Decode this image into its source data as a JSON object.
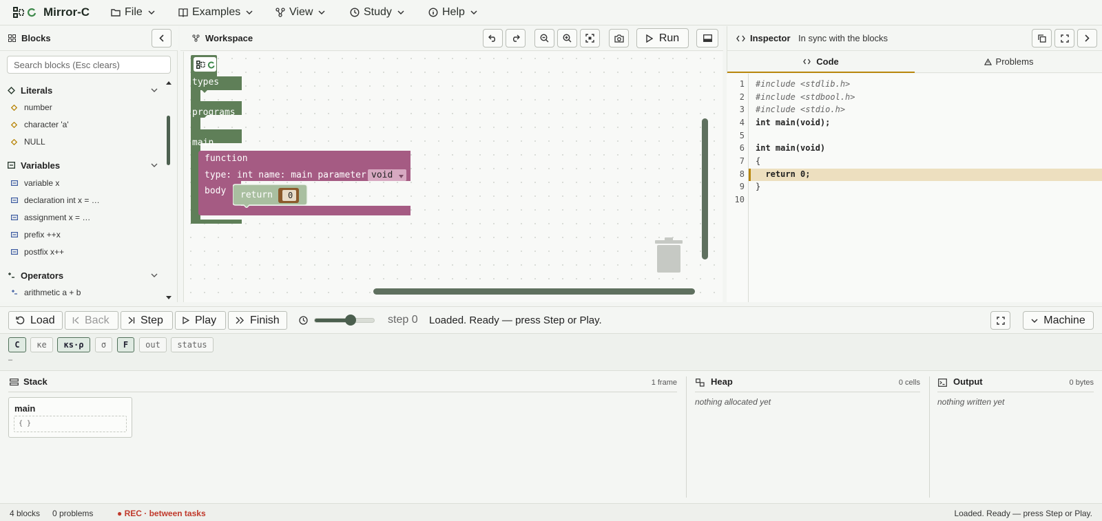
{
  "app": {
    "title": "Mirror-C"
  },
  "menu": [
    {
      "label": "File",
      "icon": "folder-icon"
    },
    {
      "label": "Examples",
      "icon": "book-icon"
    },
    {
      "label": "View",
      "icon": "network-icon"
    },
    {
      "label": "Study",
      "icon": "clock-icon"
    },
    {
      "label": "Help",
      "icon": "info-icon"
    }
  ],
  "blocks_panel": {
    "title": "Blocks",
    "search_placeholder": "Search blocks (Esc clears)",
    "categories": [
      {
        "label": "Literals",
        "items": [
          "number",
          "character 'a'",
          "NULL"
        ]
      },
      {
        "label": "Variables",
        "items": [
          "variable x",
          "declaration int x = …",
          "assignment x = …",
          "prefix ++x",
          "postfix x++"
        ]
      },
      {
        "label": "Operators",
        "items": [
          "arithmetic a + b"
        ]
      }
    ]
  },
  "workspace": {
    "title": "Workspace",
    "run_label": "Run",
    "blocks": {
      "types": "types",
      "programs": "programs",
      "main": "main",
      "function": "function",
      "signature": "type: int name: main parameter",
      "param_value": "void",
      "body": "body",
      "return": "return",
      "return_value": "0"
    }
  },
  "inspector": {
    "title": "Inspector",
    "sync_status": "In sync with the blocks",
    "tabs": [
      {
        "label": "Code",
        "active": true
      },
      {
        "label": "Problems",
        "active": false
      }
    ],
    "highlighted_line": 8,
    "code_lines": [
      "#include <stdlib.h>",
      "#include <stdbool.h>",
      "#include <stdio.h>",
      "int main(void);",
      "",
      "int main(void)",
      "{",
      "  return 0;",
      "}",
      ""
    ]
  },
  "controls": {
    "load": "Load",
    "back": "Back",
    "step": "Step",
    "play": "Play",
    "finish": "Finish",
    "speed": 0.6,
    "step_label": "step 0",
    "message": "Loaded. Ready — press Step or Play.",
    "machine": "Machine",
    "chips": [
      {
        "label": "C",
        "active": true
      },
      {
        "label": "κe",
        "active": false
      },
      {
        "label": "κs·ρ",
        "active": true
      },
      {
        "label": "σ",
        "active": false
      },
      {
        "label": "F",
        "active": true
      },
      {
        "label": "out",
        "active": false
      },
      {
        "label": "status",
        "active": false
      }
    ],
    "current": "–"
  },
  "machine": {
    "stack": {
      "title": "Stack",
      "count": "1 frame",
      "frame": "main",
      "frame_body": "{ }"
    },
    "heap": {
      "title": "Heap",
      "count": "0 cells",
      "empty": "nothing allocated yet"
    },
    "output": {
      "title": "Output",
      "count": "0 bytes",
      "empty": "nothing written yet"
    }
  },
  "statusbar": {
    "blocks": "4 blocks",
    "problems": "0 problems",
    "rec": "● REC · between tasks",
    "message": "Loaded. Ready — press Step or Play."
  },
  "colors": {
    "accent": "#b8860b",
    "block_green": "#5f7f58",
    "block_pink": "#a55b83",
    "rec_red": "#c0392b"
  }
}
